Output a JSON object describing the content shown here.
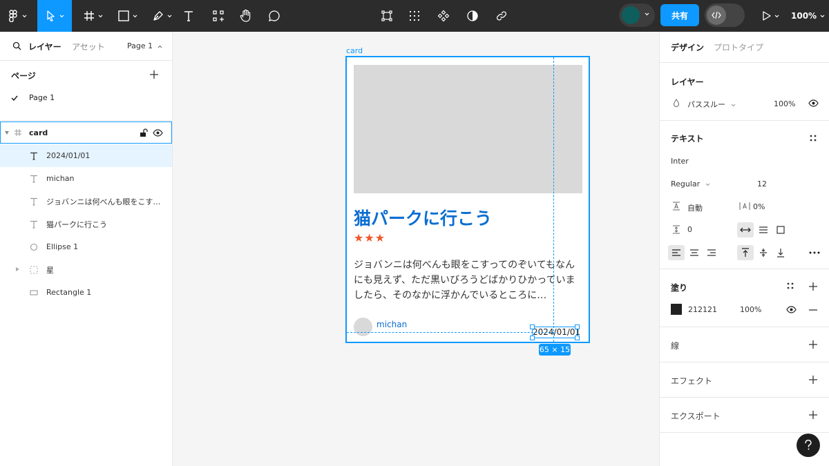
{
  "toolbar": {
    "share_label": "共有",
    "zoom_label": "100%"
  },
  "left_panel": {
    "tabs": {
      "layers": "レイヤー",
      "assets": "アセット",
      "page_selector": "Page 1"
    },
    "pages_title": "ページ",
    "pages": [
      {
        "label": "Page 1",
        "current": true
      }
    ],
    "layers": [
      {
        "name": "card",
        "type": "frame"
      },
      {
        "name": "2024/01/01",
        "type": "text"
      },
      {
        "name": "michan",
        "type": "text"
      },
      {
        "name": "ジョバンニは何べんも眼をこす…",
        "type": "text"
      },
      {
        "name": "猫パークに行こう",
        "type": "text"
      },
      {
        "name": "Ellipse 1",
        "type": "ellipse"
      },
      {
        "name": "星",
        "type": "group"
      },
      {
        "name": "Rectangle 1",
        "type": "rectangle"
      }
    ]
  },
  "canvas": {
    "frame_label": "card",
    "card": {
      "title": "猫パークに行こう",
      "stars": "★★★",
      "body": "ジョバンニは何べんも眼をこすってのぞいてもなんにも見えず、ただ黒いびろうどばかりひかっていましたら、そのなかに浮かんでいるところに…",
      "author": "michan",
      "date": "2024/01/01"
    },
    "size_badge": "65 × 15"
  },
  "right_panel": {
    "tabs": {
      "design": "デザイン",
      "prototype": "プロトタイプ"
    },
    "layer": {
      "title": "レイヤー",
      "blend_mode": "パススルー",
      "opacity": "100%"
    },
    "text": {
      "title": "テキスト",
      "font_family": "Inter",
      "font_weight": "Regular",
      "font_size": "12",
      "line_height": "自動",
      "letter_spacing": "0%",
      "paragraph_spacing": "0"
    },
    "fill": {
      "title": "塗り",
      "color_hex": "212121",
      "color": "#212121",
      "opacity": "100%"
    },
    "stroke": {
      "title": "線"
    },
    "effects": {
      "title": "エフェクト"
    },
    "export": {
      "title": "エクスポート"
    }
  },
  "colors": {
    "accent": "#0d99ff",
    "toolbar_bg": "#2c2c2c",
    "title_blue": "#0a6ed1",
    "star": "#f0562b"
  }
}
